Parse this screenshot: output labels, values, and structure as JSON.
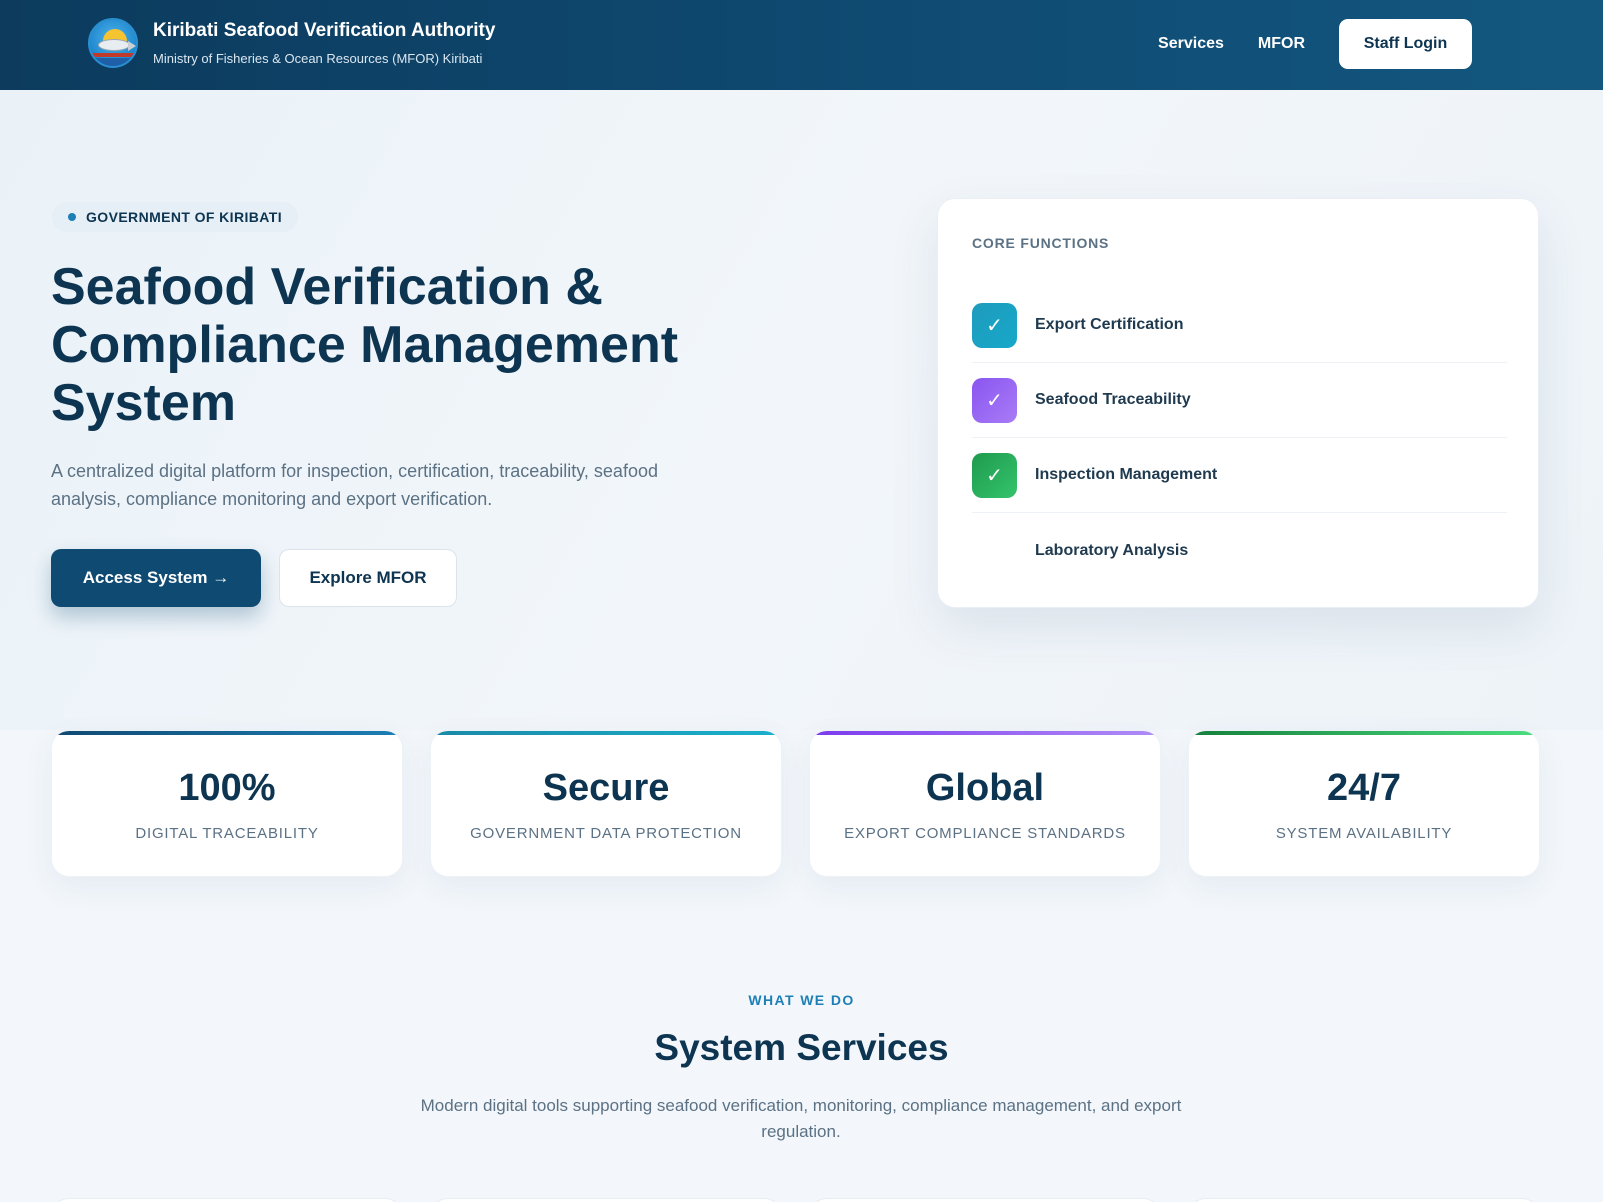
{
  "header": {
    "title": "Kiribati Seafood Verification Authority",
    "subtitle": "Ministry of Fisheries & Ocean Resources (MFOR) Kiribati",
    "nav": [
      "Services",
      "MFOR"
    ],
    "login_label": "Staff Login",
    "logo_icon": "kiribati-seal-icon"
  },
  "hero": {
    "badge": "GOVERNMENT OF KIRIBATI",
    "title_lines": [
      "Seafood Verification &",
      "Compliance Management",
      "System"
    ],
    "description": "A centralized digital platform for inspection, certification, traceability, seafood analysis, compliance monitoring and export verification.",
    "primary_button": "Access System →",
    "secondary_button": "Explore MFOR"
  },
  "core": {
    "label": "CORE FUNCTIONS",
    "items": [
      {
        "text": "Export Certification",
        "icon": "check-icon",
        "color_from": "#1f9bbd",
        "color_to": "#16a8c9",
        "show": true
      },
      {
        "text": "Seafood Traceability",
        "icon": "check-icon",
        "color_from": "#8a55f0",
        "color_to": "#a87cf6",
        "show": true
      },
      {
        "text": "Inspection Management",
        "icon": "check-icon",
        "color_from": "#1f9a4e",
        "color_to": "#34c46c",
        "show": true
      },
      {
        "text": "Laboratory Analysis",
        "icon": "",
        "color_from": "",
        "color_to": "",
        "show": false
      }
    ]
  },
  "stats": [
    {
      "value": "100%",
      "label": "DIGITAL TRACEABILITY",
      "bar_from": "#0f4a72",
      "bar_to": "#1d7fb5"
    },
    {
      "value": "Secure",
      "label": "GOVERNMENT DATA PROTECTION",
      "bar_from": "#1a8aa8",
      "bar_to": "#1ab0cc"
    },
    {
      "value": "Global",
      "label": "EXPORT COMPLIANCE STANDARDS",
      "bar_from": "#7c3aed",
      "bar_to": "#b08cf7"
    },
    {
      "value": "24/7",
      "label": "SYSTEM AVAILABILITY",
      "bar_from": "#15803d",
      "bar_to": "#4ade80"
    }
  ],
  "services": {
    "eyebrow": "WHAT WE DO",
    "title": "System Services",
    "description": "Modern digital tools supporting seafood verification, monitoring, compliance management, and export regulation."
  },
  "colors": {
    "primary": "#0f4a72",
    "text_dark": "#0d3450",
    "text_muted": "#5b7184",
    "accent": "#1d7fb5"
  }
}
